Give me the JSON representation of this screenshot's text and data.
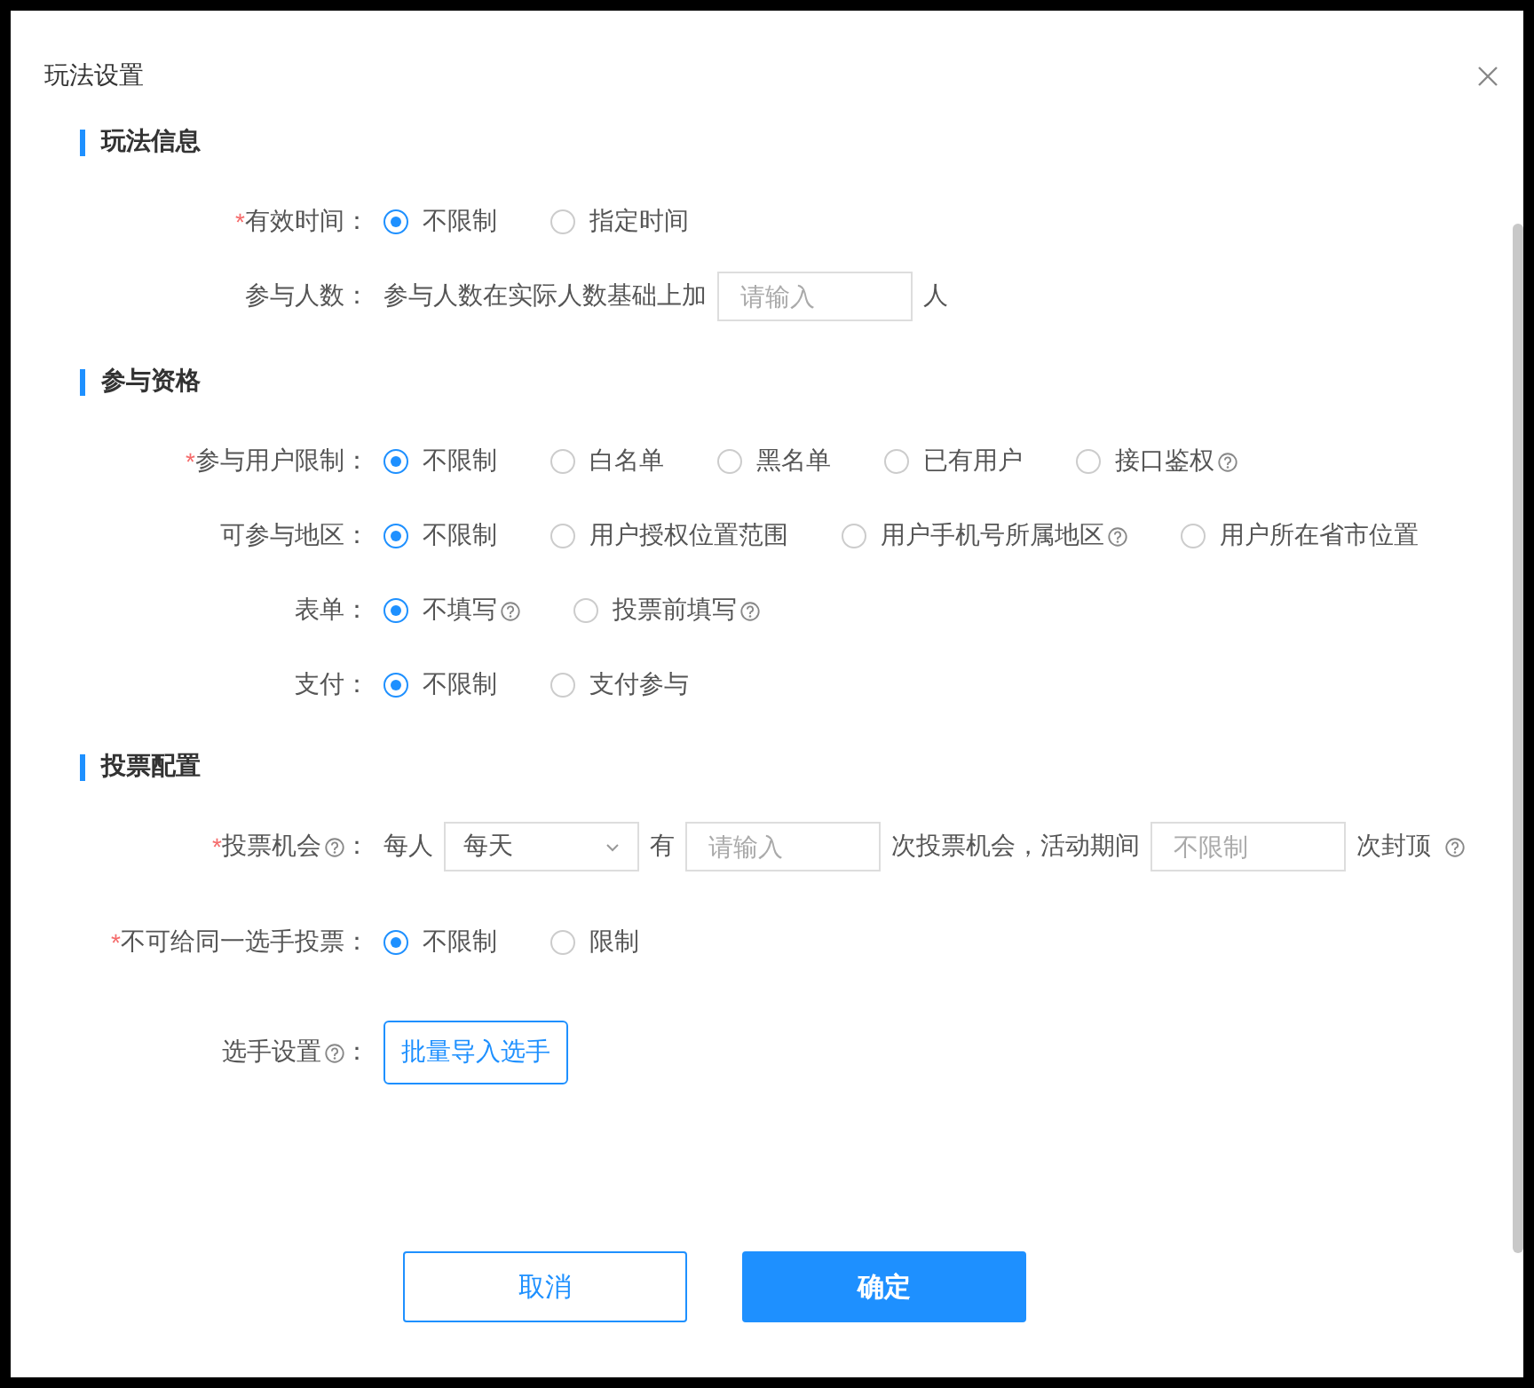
{
  "dialog": {
    "title": "玩法设置"
  },
  "sections": [
    {
      "title": "玩法信息",
      "fields": [
        {
          "kind": "radio",
          "label": "有效时间：",
          "required": true,
          "required_mark": "*",
          "help": false,
          "options": [
            {
              "label": "不限制",
              "selected": true,
              "help": false
            },
            {
              "label": "指定时间",
              "selected": false,
              "help": false
            }
          ]
        },
        {
          "kind": "inline",
          "label": "参与人数：",
          "required": false,
          "help": false,
          "parts": [
            {
              "kind": "text",
              "text": "参与人数在实际人数基础上加",
              "help": false
            },
            {
              "kind": "input",
              "placeholder": "请输入"
            },
            {
              "kind": "text",
              "text": "人",
              "help": false
            }
          ]
        }
      ]
    },
    {
      "title": "参与资格",
      "fields": [
        {
          "kind": "radio",
          "label": "参与用户限制：",
          "required": true,
          "required_mark": "*",
          "help": false,
          "options": [
            {
              "label": "不限制",
              "selected": true,
              "help": false
            },
            {
              "label": "白名单",
              "selected": false,
              "help": false
            },
            {
              "label": "黑名单",
              "selected": false,
              "help": false
            },
            {
              "label": "已有用户",
              "selected": false,
              "help": false
            },
            {
              "label": "接口鉴权",
              "selected": false,
              "help": true
            }
          ]
        },
        {
          "kind": "radio",
          "label": "可参与地区：",
          "required": false,
          "help": false,
          "options": [
            {
              "label": "不限制",
              "selected": true,
              "help": false
            },
            {
              "label": "用户授权位置范围",
              "selected": false,
              "help": false
            },
            {
              "label": "用户手机号所属地区",
              "selected": false,
              "help": true
            },
            {
              "label": "用户所在省市位置",
              "selected": false,
              "help": false
            }
          ]
        },
        {
          "kind": "radio",
          "label": "表单：",
          "required": false,
          "help": false,
          "options": [
            {
              "label": "不填写",
              "selected": true,
              "help": true
            },
            {
              "label": "投票前填写",
              "selected": false,
              "help": true
            }
          ]
        },
        {
          "kind": "radio",
          "label": "支付：",
          "required": false,
          "help": false,
          "options": [
            {
              "label": "不限制",
              "selected": true,
              "help": false
            },
            {
              "label": "支付参与",
              "selected": false,
              "help": false
            }
          ]
        }
      ]
    },
    {
      "title": "投票配置",
      "fields": [
        {
          "kind": "inline",
          "label": "投票机会",
          "label_suffix": "：",
          "required": true,
          "required_mark": "*",
          "help": true,
          "parts": [
            {
              "kind": "text",
              "text": "每人",
              "help": false
            },
            {
              "kind": "select",
              "value": "每天"
            },
            {
              "kind": "text",
              "text": "有",
              "help": false
            },
            {
              "kind": "input",
              "placeholder": "请输入"
            },
            {
              "kind": "text",
              "text": "次投票机会，活动期间",
              "help": false
            },
            {
              "kind": "input",
              "placeholder": "不限制"
            },
            {
              "kind": "text",
              "text": "次封顶",
              "help": true
            }
          ]
        },
        {
          "kind": "radio",
          "label": "不可给同一选手投票：",
          "required": true,
          "required_mark": "*",
          "help": false,
          "options": [
            {
              "label": "不限制",
              "selected": true,
              "help": false
            },
            {
              "label": "限制",
              "selected": false,
              "help": false
            }
          ]
        },
        {
          "kind": "button",
          "label": "选手设置",
          "label_suffix": "：",
          "required": false,
          "help": true,
          "button": "批量导入选手"
        }
      ]
    }
  ],
  "footer": {
    "buttons": [
      {
        "label": "取消",
        "kind": "secondary"
      },
      {
        "label": "确定",
        "kind": "primary"
      }
    ]
  }
}
